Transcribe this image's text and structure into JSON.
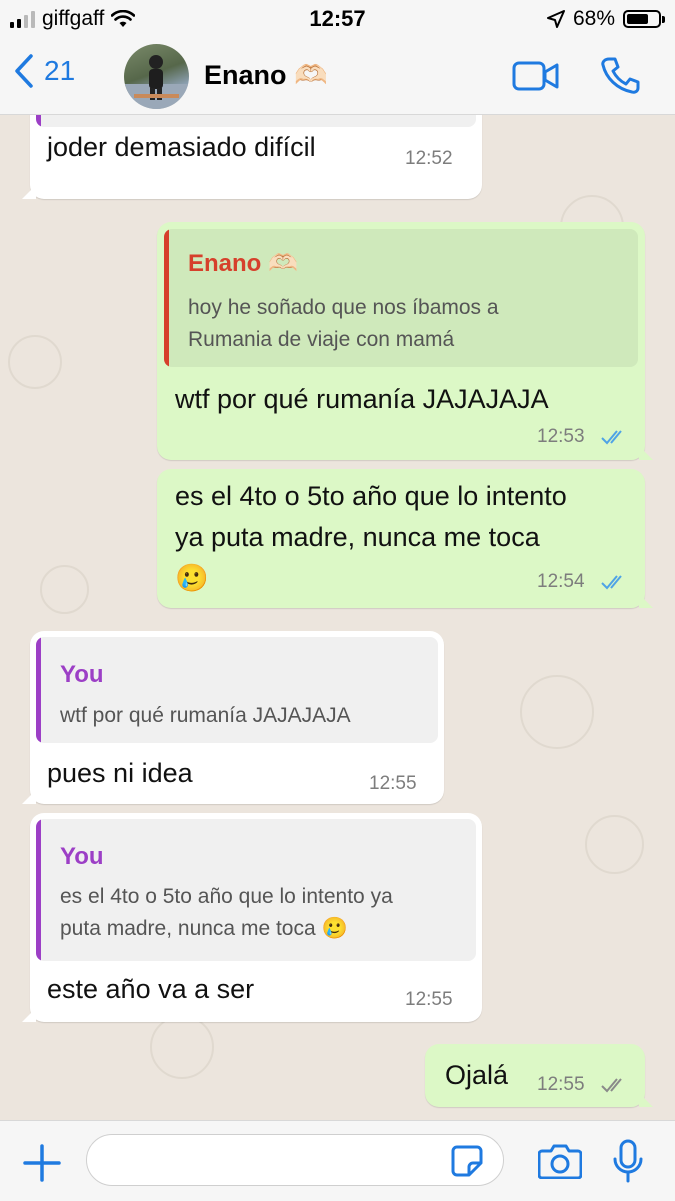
{
  "status_bar": {
    "carrier": "giffgaff",
    "time": "12:57",
    "battery": "68%"
  },
  "header": {
    "back_count": "21",
    "contact_name": "Enano 🫶🏻"
  },
  "messages": [
    {
      "direction": "in",
      "text": "joder demasiado difícil",
      "time": "12:52"
    },
    {
      "direction": "out",
      "quote_author": "Enano 🫶🏻",
      "quote_line1": "hoy he soñado que nos íbamos a",
      "quote_line2": "Rumania de viaje con mamá",
      "text": "wtf por qué rumanía JAJAJAJA",
      "time": "12:53",
      "status": "read"
    },
    {
      "direction": "out",
      "line1": "es el 4to o 5to año que lo intento",
      "line2": "ya puta madre, nunca me toca",
      "line3": "🥲",
      "time": "12:54",
      "status": "read"
    },
    {
      "direction": "in",
      "quote_author": "You",
      "quote_line1": "wtf por qué rumanía JAJAJAJA",
      "text": "pues ni idea",
      "time": "12:55"
    },
    {
      "direction": "in",
      "quote_author": "You",
      "quote_line1": "es el 4to o 5to año que lo intento ya",
      "quote_line2": "puta madre, nunca me toca 🥲",
      "text": "este año va a ser",
      "time": "12:55"
    },
    {
      "direction": "out",
      "text": "Ojalá",
      "time": "12:55",
      "status": "delivered"
    }
  ],
  "input": {
    "placeholder": ""
  },
  "colors": {
    "accent": "#1f7ae0",
    "outgoing_bubble": "#dcf8c6",
    "incoming_bubble": "#ffffff",
    "quote_author_contact": "#d6402b",
    "quote_author_you": "#9c3fc6",
    "read_ticks": "#4fa3e6"
  }
}
